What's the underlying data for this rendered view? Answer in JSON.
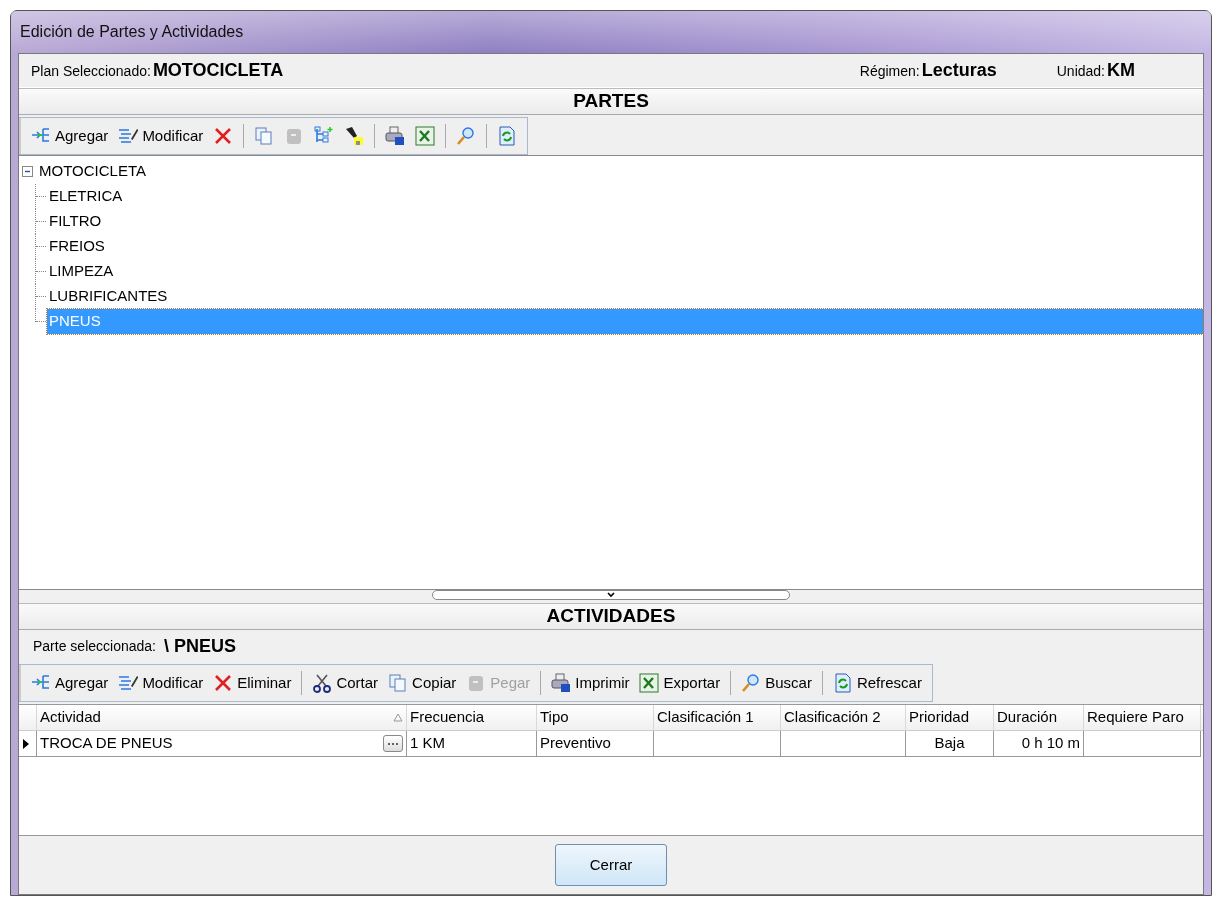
{
  "window": {
    "title": "Edición de Partes y Actividades"
  },
  "header": [
    {
      "label": "Plan Seleccionado:",
      "value": "MOTOCICLETA"
    },
    {
      "label": "Régimen:",
      "value": "Lecturas"
    },
    {
      "label": "Unidad:",
      "value": "KM"
    }
  ],
  "parts": {
    "title": "PARTES",
    "toolbar": [
      {
        "kind": "button",
        "label": "Agregar",
        "disabled": false
      },
      {
        "kind": "button",
        "label": "Modificar",
        "disabled": false
      },
      {
        "kind": "button",
        "disabled": false
      },
      {
        "kind": "separator"
      },
      {
        "kind": "button",
        "disabled": false
      },
      {
        "kind": "button",
        "disabled": true
      },
      {
        "kind": "button",
        "disabled": false
      },
      {
        "kind": "button",
        "disabled": false
      },
      {
        "kind": "separator"
      },
      {
        "kind": "button",
        "disabled": false
      },
      {
        "kind": "button",
        "disabled": false
      },
      {
        "kind": "separator"
      },
      {
        "kind": "button",
        "disabled": false
      },
      {
        "kind": "separator"
      },
      {
        "kind": "button",
        "disabled": false
      }
    ],
    "tree": [
      {
        "label": "MOTOCICLETA",
        "expanded": true,
        "selected": false,
        "children": [
          {
            "label": "ELETRICA",
            "selected": false
          },
          {
            "label": "FILTRO",
            "selected": false
          },
          {
            "label": "FREIOS",
            "selected": false
          },
          {
            "label": "LIMPEZA",
            "selected": false
          },
          {
            "label": "LUBRIFICANTES",
            "selected": false
          },
          {
            "label": "PNEUS",
            "selected": true
          }
        ]
      }
    ]
  },
  "activities": {
    "title": "ACTIVIDADES",
    "selected_part": {
      "label": "Parte seleccionada:",
      "value": "\\ PNEUS"
    },
    "toolbar": [
      {
        "kind": "button",
        "label": "Agregar",
        "disabled": false
      },
      {
        "kind": "button",
        "label": "Modificar",
        "disabled": false
      },
      {
        "kind": "button",
        "label": "Eliminar",
        "disabled": false
      },
      {
        "kind": "separator"
      },
      {
        "kind": "button",
        "label": "Cortar",
        "disabled": false
      },
      {
        "kind": "button",
        "label": "Copiar",
        "disabled": false
      },
      {
        "kind": "button",
        "label": "Pegar",
        "disabled": true
      },
      {
        "kind": "separator"
      },
      {
        "kind": "button",
        "label": "Imprimir",
        "disabled": false
      },
      {
        "kind": "button",
        "label": "Exportar",
        "disabled": false
      },
      {
        "kind": "separator"
      },
      {
        "kind": "button",
        "label": "Buscar",
        "disabled": false
      },
      {
        "kind": "separator"
      },
      {
        "kind": "button",
        "label": "Refrescar",
        "disabled": false
      }
    ],
    "table": {
      "columns": [
        {
          "label": "Actividad",
          "sorted": true
        },
        {
          "label": "Frecuencia",
          "sorted": false
        },
        {
          "label": "Tipo",
          "sorted": false
        },
        {
          "label": "Clasificación 1",
          "sorted": false
        },
        {
          "label": "Clasificación 2",
          "sorted": false
        },
        {
          "label": "Prioridad",
          "sorted": false
        },
        {
          "label": "Duración",
          "sorted": false
        },
        {
          "label": "Requiere Paro",
          "sorted": false
        }
      ],
      "rows": [
        {
          "current": true,
          "cells": [
            "TROCA DE PNEUS",
            "1 KM",
            "Preventivo",
            "",
            "",
            "Baja",
            "0 h 10 m",
            ""
          ]
        }
      ]
    }
  },
  "footer": {
    "button": "Cerrar"
  }
}
